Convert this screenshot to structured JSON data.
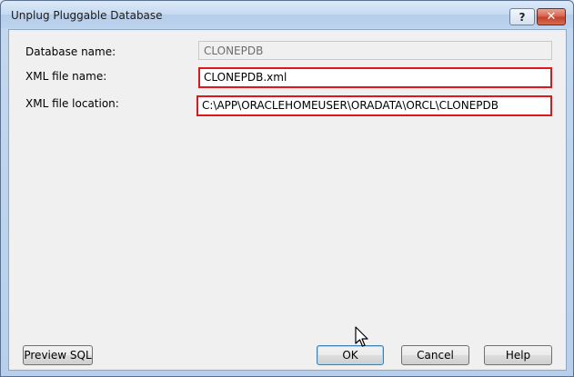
{
  "window": {
    "title": "Unplug Pluggable Database",
    "help_glyph": "?",
    "close_glyph": "✕"
  },
  "form": {
    "database_name_label": "Database name:",
    "database_name_value": "CLONEPDB",
    "xml_file_name_label": "XML file name:",
    "xml_file_name_value": "CLONEPDB.xml",
    "xml_file_location_label": "XML file location:",
    "xml_file_location_value": "C:\\APP\\ORACLEHOMEUSER\\ORADATA\\ORCL\\CLONEPDB"
  },
  "buttons": {
    "preview_sql": "Preview SQL",
    "ok": "OK",
    "cancel": "Cancel",
    "help": "Help"
  },
  "colors": {
    "highlight": "#e0161c"
  },
  "icons": {
    "cursor": "mouse-pointer-icon"
  }
}
